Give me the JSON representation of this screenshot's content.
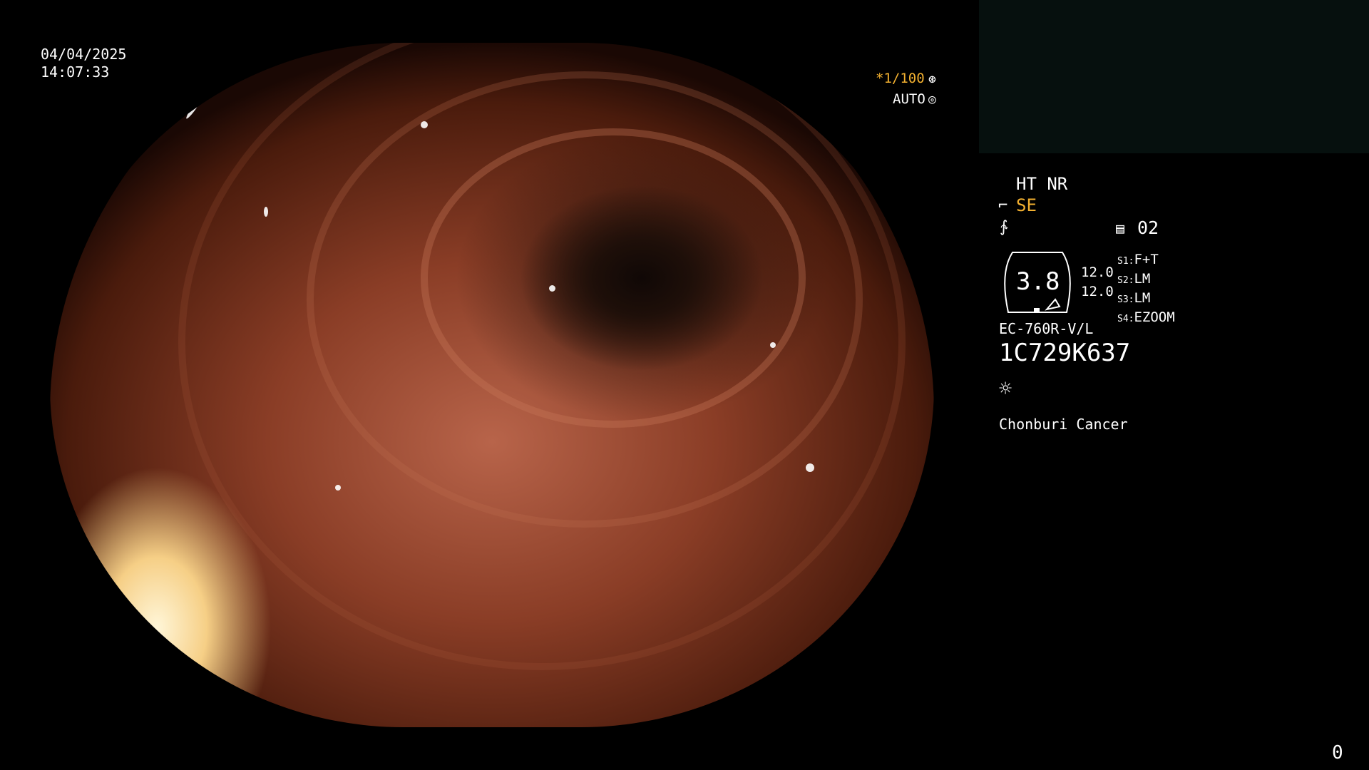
{
  "datetime": {
    "date": "04/04/2025",
    "time": "14:07:33"
  },
  "shutter": {
    "value": "*1/100",
    "mode": "AUTO"
  },
  "modes": {
    "top": "HT NR",
    "structure": "SE"
  },
  "memory": {
    "value": "02"
  },
  "scope": {
    "zoom": "3.8",
    "val1": "12.0",
    "val2": "12.0",
    "model": "EC-760R-V/L",
    "serial": "1C729K637"
  },
  "switches": [
    {
      "key": "S1",
      "value": "F+T"
    },
    {
      "key": "S2",
      "value": "LM"
    },
    {
      "key": "S3",
      "value": "LM"
    },
    {
      "key": "S4",
      "value": "EZOOM"
    }
  ],
  "institution": "Chonburi Cancer",
  "counter": "0",
  "colors": {
    "accent": "#f2b030",
    "text": "#ffffff"
  }
}
